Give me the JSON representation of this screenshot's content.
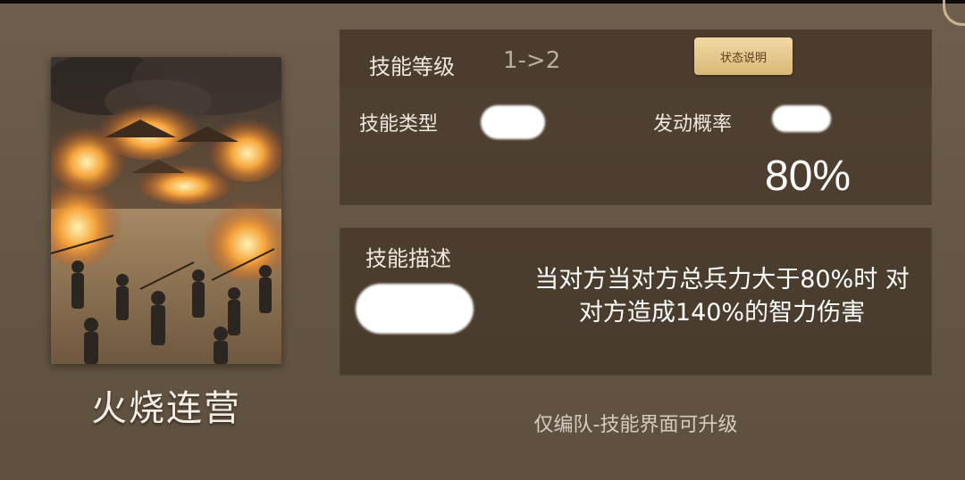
{
  "skill": {
    "name": "火烧连营",
    "art_icon": "burning-camp-artwork"
  },
  "level": {
    "label": "技能等级",
    "value": "1->2",
    "status_button": "状态说明"
  },
  "type": {
    "label": "技能类型"
  },
  "probability": {
    "label": "发动概率",
    "value": "80%"
  },
  "description": {
    "label": "技能描述",
    "text": "当对方当对方总兵力大于80%时 对对方造成140%的智力伤害"
  },
  "footer": {
    "note": "仅编队-技能界面可升级"
  },
  "colors": {
    "accent_gold": "#e3c88f",
    "panel": "#3e2f22",
    "background": "#6b5a49",
    "text": "#efe8de"
  },
  "icons": {
    "corner": "bracket-icon"
  }
}
